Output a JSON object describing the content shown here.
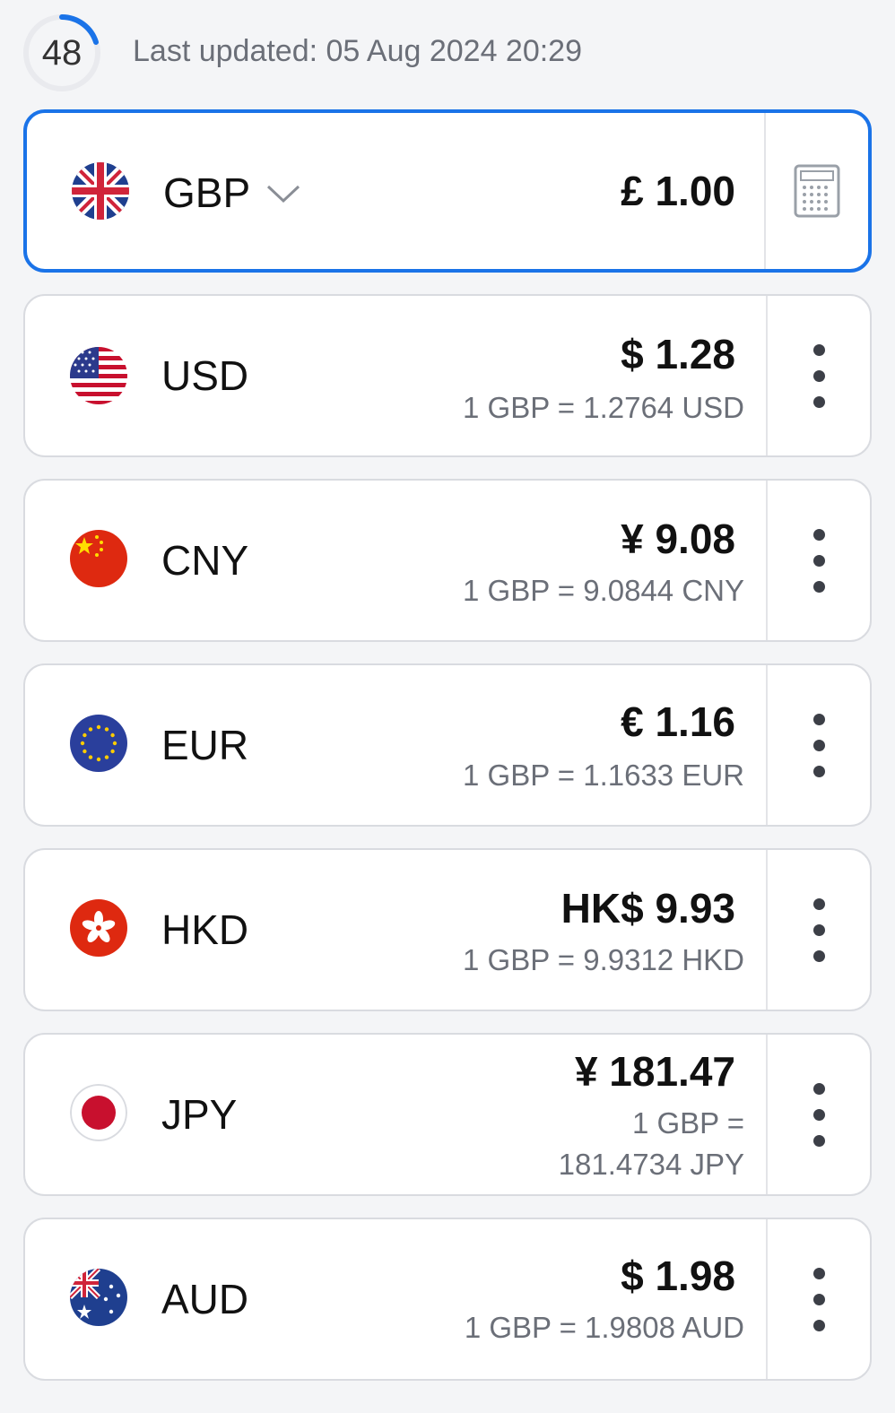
{
  "header": {
    "countdown": "48",
    "countdown_progress": 0.2,
    "last_updated": "Last updated: 05 Aug 2024 20:29"
  },
  "base": {
    "code": "GBP",
    "amount": "£ 1.00",
    "flag_icon": "uk-flag-icon",
    "action_icon": "calculator-icon"
  },
  "currencies": [
    {
      "code": "USD",
      "amount": "$ 1.28",
      "rate": "1 GBP = 1.2764 USD",
      "flag_icon": "us-flag-icon"
    },
    {
      "code": "CNY",
      "amount": "¥ 9.08",
      "rate": "1 GBP = 9.0844 CNY",
      "flag_icon": "cn-flag-icon"
    },
    {
      "code": "EUR",
      "amount": "€ 1.16",
      "rate": "1 GBP = 1.1633 EUR",
      "flag_icon": "eu-flag-icon"
    },
    {
      "code": "HKD",
      "amount": "HK$ 9.93",
      "rate": "1 GBP = 9.9312 HKD",
      "flag_icon": "hk-flag-icon"
    },
    {
      "code": "JPY",
      "amount": "¥ 181.47",
      "rate_line1": "1 GBP =",
      "rate_line2": "181.4734 JPY",
      "flag_icon": "jp-flag-icon"
    },
    {
      "code": "AUD",
      "amount": "$ 1.98",
      "rate": "1 GBP = 1.9808 AUD",
      "flag_icon": "au-flag-icon"
    }
  ],
  "colors": {
    "accent": "#1a73e8",
    "muted_text": "#6b6f78",
    "background": "#f4f5f7"
  }
}
